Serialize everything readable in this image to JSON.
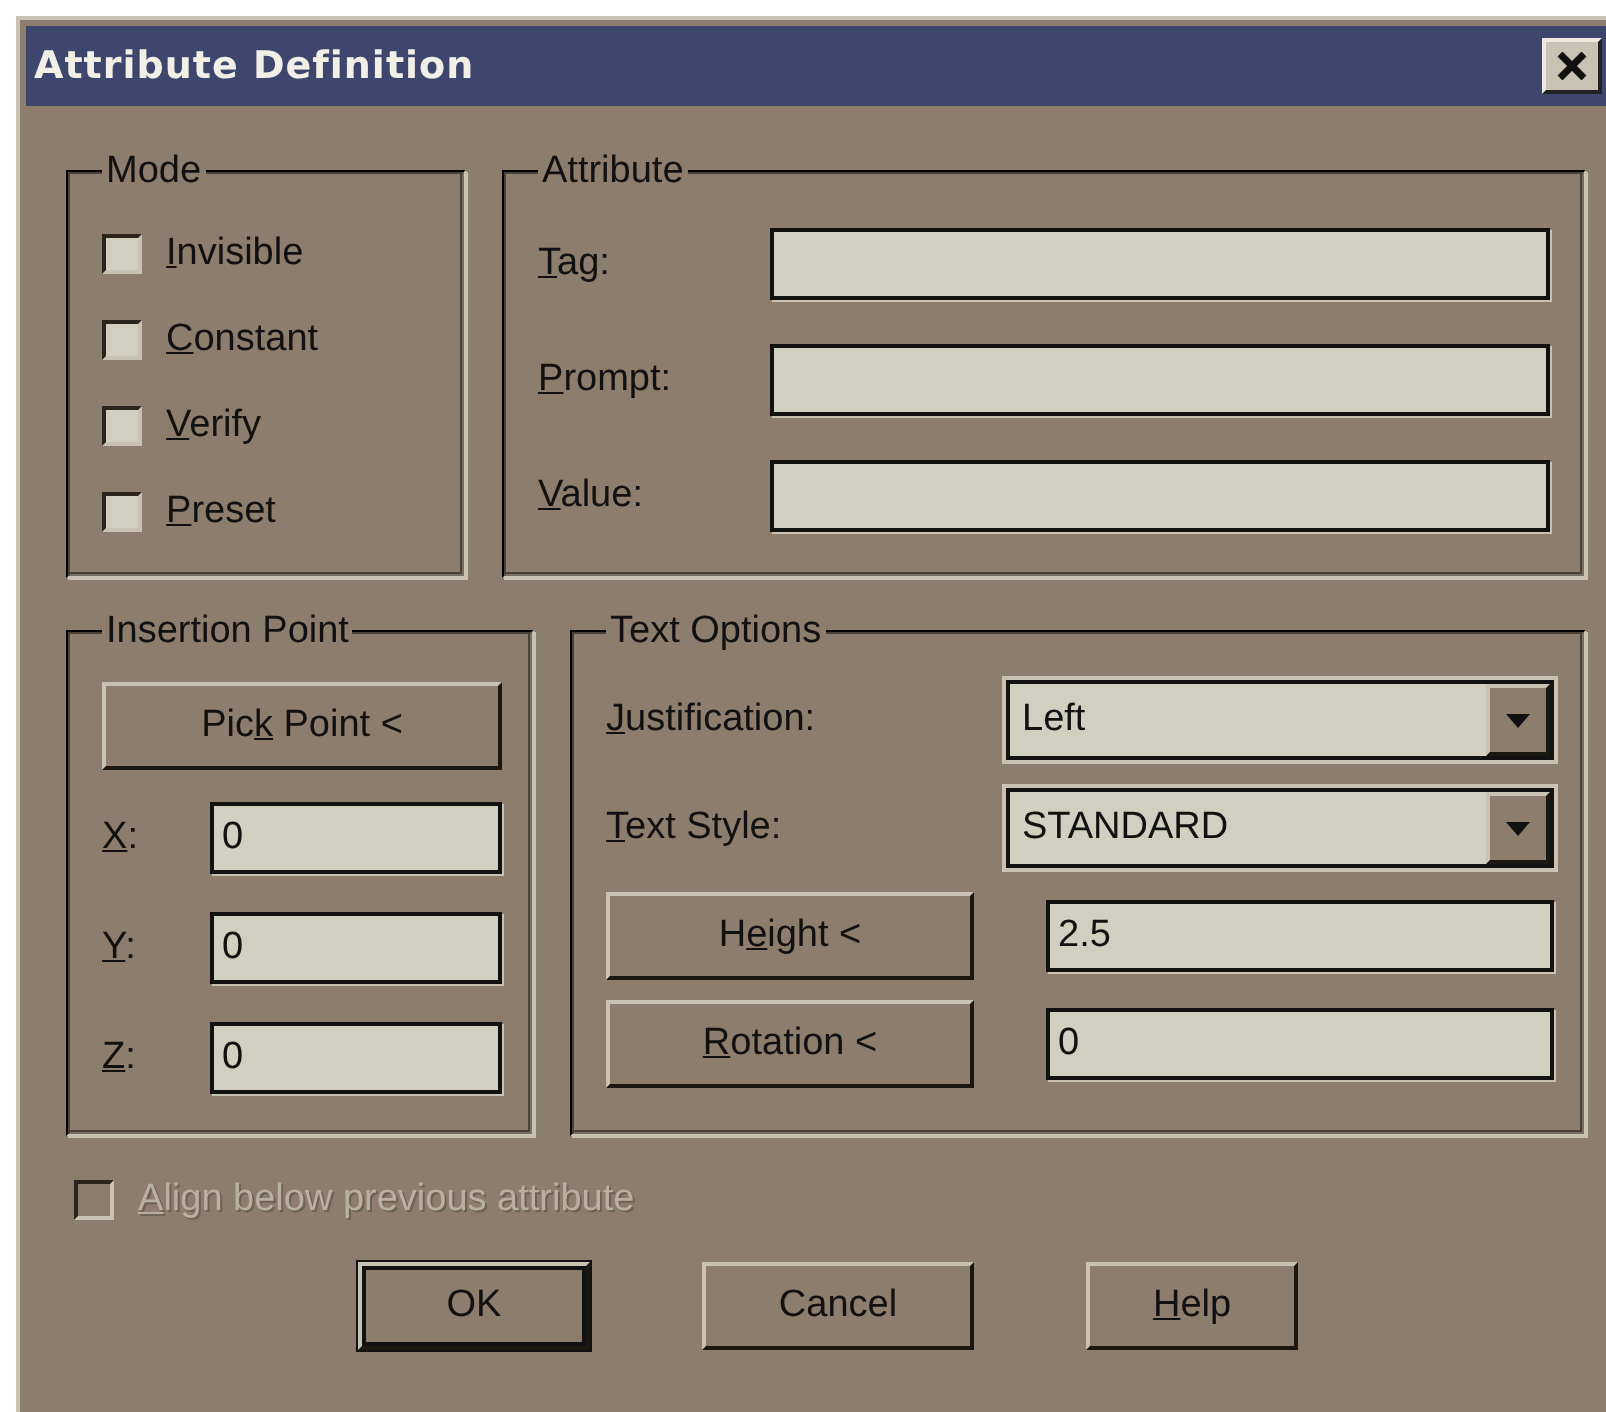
{
  "window": {
    "title": "Attribute Definition"
  },
  "mode": {
    "title": "Mode",
    "options": [
      {
        "label": {
          "key": "I",
          "post": "nvisible"
        },
        "checked": false
      },
      {
        "label": {
          "key": "C",
          "post": "onstant"
        },
        "checked": false
      },
      {
        "label": {
          "key": "V",
          "post": "erify"
        },
        "checked": false
      },
      {
        "label": {
          "key": "P",
          "post": "reset"
        },
        "checked": false
      }
    ]
  },
  "attribute": {
    "title": "Attribute",
    "fields": [
      {
        "label": {
          "key": "T",
          "post": "ag:"
        }
      },
      {
        "label": {
          "key": "P",
          "post": "rompt:"
        }
      },
      {
        "label": {
          "key": "V",
          "post": "alue:"
        }
      }
    ]
  },
  "insertion_point": {
    "title": "Insertion Point",
    "pick_button": {
      "pre": "Pic",
      "key": "k",
      "post": " Point <"
    },
    "coords": [
      {
        "label": {
          "key": "X",
          "post": ":"
        },
        "value": "0"
      },
      {
        "label": {
          "key": "Y",
          "post": ":"
        },
        "value": "0"
      },
      {
        "label": {
          "key": "Z",
          "post": ":"
        },
        "value": "0"
      }
    ]
  },
  "text_options": {
    "title": "Text Options",
    "rows": [
      {
        "kind": "dropdown",
        "label": {
          "key": "J",
          "post": "ustification:"
        },
        "value": "Left"
      },
      {
        "kind": "dropdown",
        "label": {
          "key": "T",
          "post": "ext Style:"
        },
        "value": "STANDARD"
      },
      {
        "kind": "button",
        "label": {
          "pre": "H",
          "key": "e",
          "post": "ight <"
        },
        "value": "2.5"
      },
      {
        "kind": "button",
        "label": {
          "key": "R",
          "post": "otation <"
        },
        "value": "0"
      }
    ]
  },
  "align_below": {
    "label": {
      "key": "A",
      "post": "lign below previous attribute"
    },
    "checked": false,
    "disabled": true
  },
  "buttons": [
    {
      "label": {
        "pre": "OK"
      },
      "default": true
    },
    {
      "label": {
        "pre": "Cancel"
      },
      "default": false
    },
    {
      "label": {
        "key": "H",
        "post": "elp"
      },
      "default": false
    }
  ]
}
